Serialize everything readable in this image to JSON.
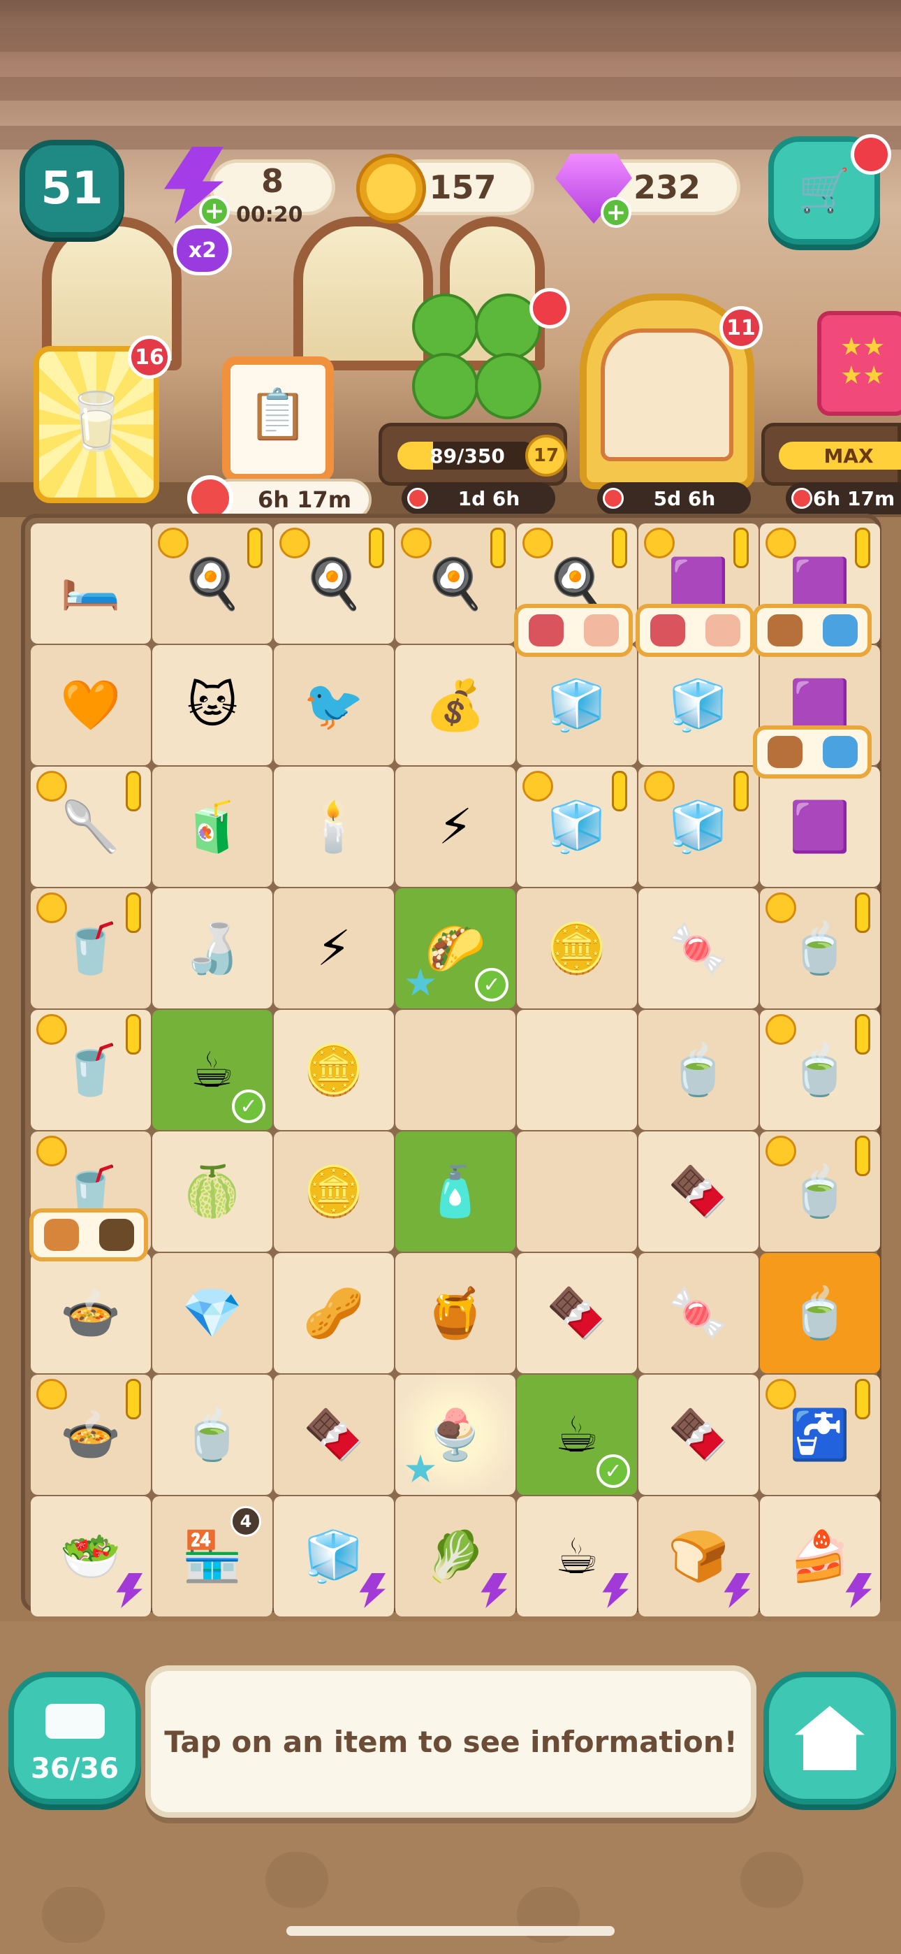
{
  "hud": {
    "level": "51",
    "energy": {
      "count": "8",
      "timer": "00:20",
      "multiplier": "x2"
    },
    "coins": "157",
    "gems": "232"
  },
  "events": {
    "juice_badge": "16",
    "task_timer": "6h 17m",
    "clover": {
      "progress_text": "89/350",
      "progress_fraction": 0.254,
      "level": "17",
      "timer": "1d 6h"
    },
    "house": {
      "badge": "11",
      "timer": "5d 6h"
    },
    "pink_pack": {
      "label": "MAX",
      "timer": "6h 17m"
    }
  },
  "board": {
    "rows": [
      [
        {
          "icon": "pet-bed-icon",
          "emoji": "🛏️",
          "bg": "#f5e3c7"
        },
        {
          "icon": "frying-pan-icon",
          "emoji": "🍳",
          "bubble": true,
          "alert": true
        },
        {
          "icon": "frying-pan-icon",
          "emoji": "🍳",
          "bubble": true,
          "alert": true
        },
        {
          "icon": "frying-pan-icon",
          "emoji": "🍳",
          "bubble": true,
          "alert": true
        },
        {
          "icon": "frying-pan-icon",
          "emoji": "🍳",
          "bubble": true,
          "alert": true
        },
        {
          "icon": "oven-icon",
          "emoji": "🟪",
          "bubble": true,
          "alert": true
        },
        {
          "icon": "oven-icon",
          "emoji": "🟪",
          "bubble": true,
          "alert": true
        }
      ],
      [
        {
          "icon": "cat-cushion-icon",
          "emoji": "🧡"
        },
        {
          "icon": "cat-toy-icon",
          "emoji": "🐱"
        },
        {
          "icon": "bird-toy-icon",
          "emoji": "🐦"
        },
        {
          "icon": "coin-stack-icon",
          "emoji": "💰"
        },
        {
          "icon": "deep-fryer-icon",
          "emoji": "🧊"
        },
        {
          "icon": "deep-fryer-icon",
          "emoji": "🧊"
        },
        {
          "icon": "oven-icon",
          "emoji": "🟪"
        }
      ],
      [
        {
          "icon": "hand-mixer-icon",
          "emoji": "🥄",
          "bubble": true,
          "alert": true
        },
        {
          "icon": "juice-bottle-icon",
          "emoji": "🧃"
        },
        {
          "icon": "candle-warmer-icon",
          "emoji": "🕯️"
        },
        {
          "icon": "energy-bolt-icon",
          "emoji": "⚡"
        },
        {
          "icon": "deep-fryer-icon",
          "emoji": "🧊",
          "bubble": true,
          "alert": true
        },
        {
          "icon": "deep-fryer-icon",
          "emoji": "🧊",
          "bubble": true,
          "alert": true
        },
        {
          "icon": "oven-icon",
          "emoji": "🟪"
        }
      ],
      [
        {
          "icon": "blender-icon",
          "emoji": "🥤",
          "bubble": true,
          "alert": true
        },
        {
          "icon": "soda-bottle-icon",
          "emoji": "🍶"
        },
        {
          "icon": "energy-bundle-icon",
          "emoji": "⚡"
        },
        {
          "icon": "tacos-icon",
          "emoji": "🌮",
          "green": true,
          "check": true,
          "star": true
        },
        {
          "icon": "coin-pair-icon",
          "emoji": "🪙"
        },
        {
          "icon": "marshmallow-icon",
          "emoji": "🍬"
        },
        {
          "icon": "tea-table-icon",
          "emoji": "🍵",
          "bubble": true,
          "alert": true
        }
      ],
      [
        {
          "icon": "blender-icon",
          "emoji": "🥤",
          "bubble": true,
          "alert": true
        },
        {
          "icon": "coffee-dripper-icon",
          "emoji": "☕",
          "green": true,
          "check": true
        },
        {
          "icon": "coin-icon",
          "emoji": "🪙"
        },
        {
          "icon": "empty-cell",
          "emoji": ""
        },
        {
          "icon": "empty-cell",
          "emoji": ""
        },
        {
          "icon": "tea-bags-icon",
          "emoji": "🍵"
        },
        {
          "icon": "tea-table-icon",
          "emoji": "🍵",
          "bubble": true,
          "alert": true
        }
      ],
      [
        {
          "icon": "blender-icon",
          "emoji": "🥤",
          "bubble": true
        },
        {
          "icon": "lime-icon",
          "emoji": "🍈"
        },
        {
          "icon": "coin-pair-icon",
          "emoji": "🪙"
        },
        {
          "icon": "extract-bottle-icon",
          "emoji": "🧴",
          "green": true
        },
        {
          "icon": "empty-cell",
          "emoji": ""
        },
        {
          "icon": "syrup-bottle-icon",
          "emoji": "🍫"
        },
        {
          "icon": "tea-table-icon",
          "emoji": "🍵",
          "bubble": true,
          "alert": true
        }
      ],
      [
        {
          "icon": "cooking-pot-icon",
          "emoji": "🍲"
        },
        {
          "icon": "gem-cluster-icon",
          "emoji": "💎"
        },
        {
          "icon": "pistachio-icon",
          "emoji": "🥜"
        },
        {
          "icon": "honey-bear-icon",
          "emoji": "🍯"
        },
        {
          "icon": "chocolate-bar-icon",
          "emoji": "🍫"
        },
        {
          "icon": "candy-icon",
          "emoji": "🍬"
        },
        {
          "icon": "tea-table-icon",
          "emoji": "🍵",
          "orange": true
        }
      ],
      [
        {
          "icon": "cooking-pot-icon",
          "emoji": "🍲",
          "bubble": true,
          "alert": true
        },
        {
          "icon": "tea-cup-icon",
          "emoji": "🍵"
        },
        {
          "icon": "chocolate-bar-icon",
          "emoji": "🍫"
        },
        {
          "icon": "ice-cream-sundae-icon",
          "emoji": "🍨",
          "glow": true,
          "star": true
        },
        {
          "icon": "coffee-dripper-icon",
          "emoji": "☕",
          "green": true,
          "check": true
        },
        {
          "icon": "fudge-cubes-icon",
          "emoji": "🍫"
        },
        {
          "icon": "sink-table-icon",
          "emoji": "🚰",
          "bubble": true,
          "alert": true
        }
      ],
      [
        {
          "icon": "salad-platter-icon",
          "emoji": "🥗",
          "lock": true
        },
        {
          "icon": "soda-fountain-icon",
          "emoji": "🏪",
          "count": "4"
        },
        {
          "icon": "vending-machine-icon",
          "emoji": "🧊",
          "lock": true
        },
        {
          "icon": "veggie-cart-icon",
          "emoji": "🥬",
          "lock": true
        },
        {
          "icon": "coffee-cart-icon",
          "emoji": "☕",
          "lock": true
        },
        {
          "icon": "toaster-icon",
          "emoji": "🍞",
          "lock": true
        },
        {
          "icon": "cake-stand-icon",
          "emoji": "🍰",
          "lock": true
        }
      ]
    ]
  },
  "bottom": {
    "inventory": "36/36",
    "info_text": "Tap on an item to see information!"
  },
  "colors": {
    "accent": "#3ec8b4",
    "energy": "#a43de8",
    "coin": "#ffcd3a",
    "gem": "#d14ef0",
    "alert_red": "#e43946",
    "board_bg": "#8b6a4e"
  }
}
